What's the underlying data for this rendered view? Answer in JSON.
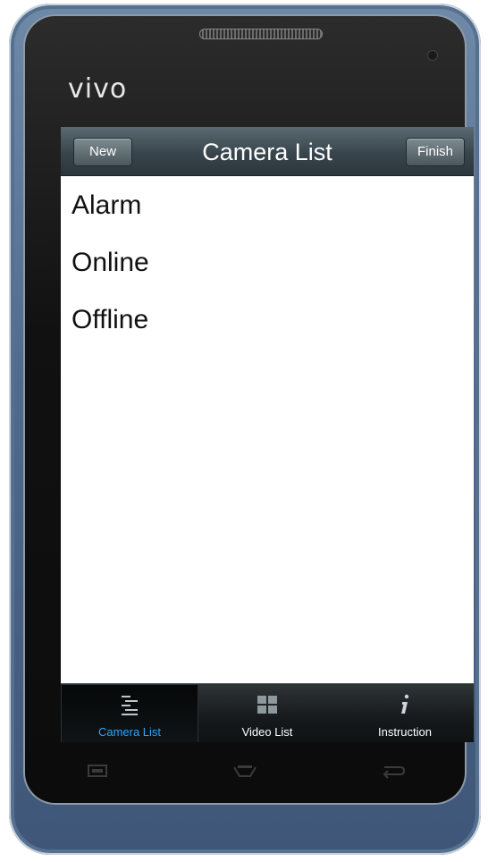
{
  "device": {
    "brand": "vivo"
  },
  "header": {
    "left_button": "New",
    "title": "Camera List",
    "right_button": "Finish"
  },
  "list": {
    "items": [
      {
        "label": "Alarm"
      },
      {
        "label": "Online"
      },
      {
        "label": "Offline"
      }
    ]
  },
  "tabbar": {
    "active_index": 0,
    "tabs": [
      {
        "label": "Camera List",
        "icon": "list-icon"
      },
      {
        "label": "Video List",
        "icon": "grid-icon"
      },
      {
        "label": "Instruction",
        "icon": "info-icon"
      }
    ]
  },
  "colors": {
    "active_tab_label": "#2aa4ff",
    "titlebar": "#38454c",
    "phone_body": "#4f6a8c"
  },
  "hardware_keys": [
    {
      "icon": "menu-key-icon"
    },
    {
      "icon": "home-key-icon"
    },
    {
      "icon": "back-key-icon"
    }
  ]
}
